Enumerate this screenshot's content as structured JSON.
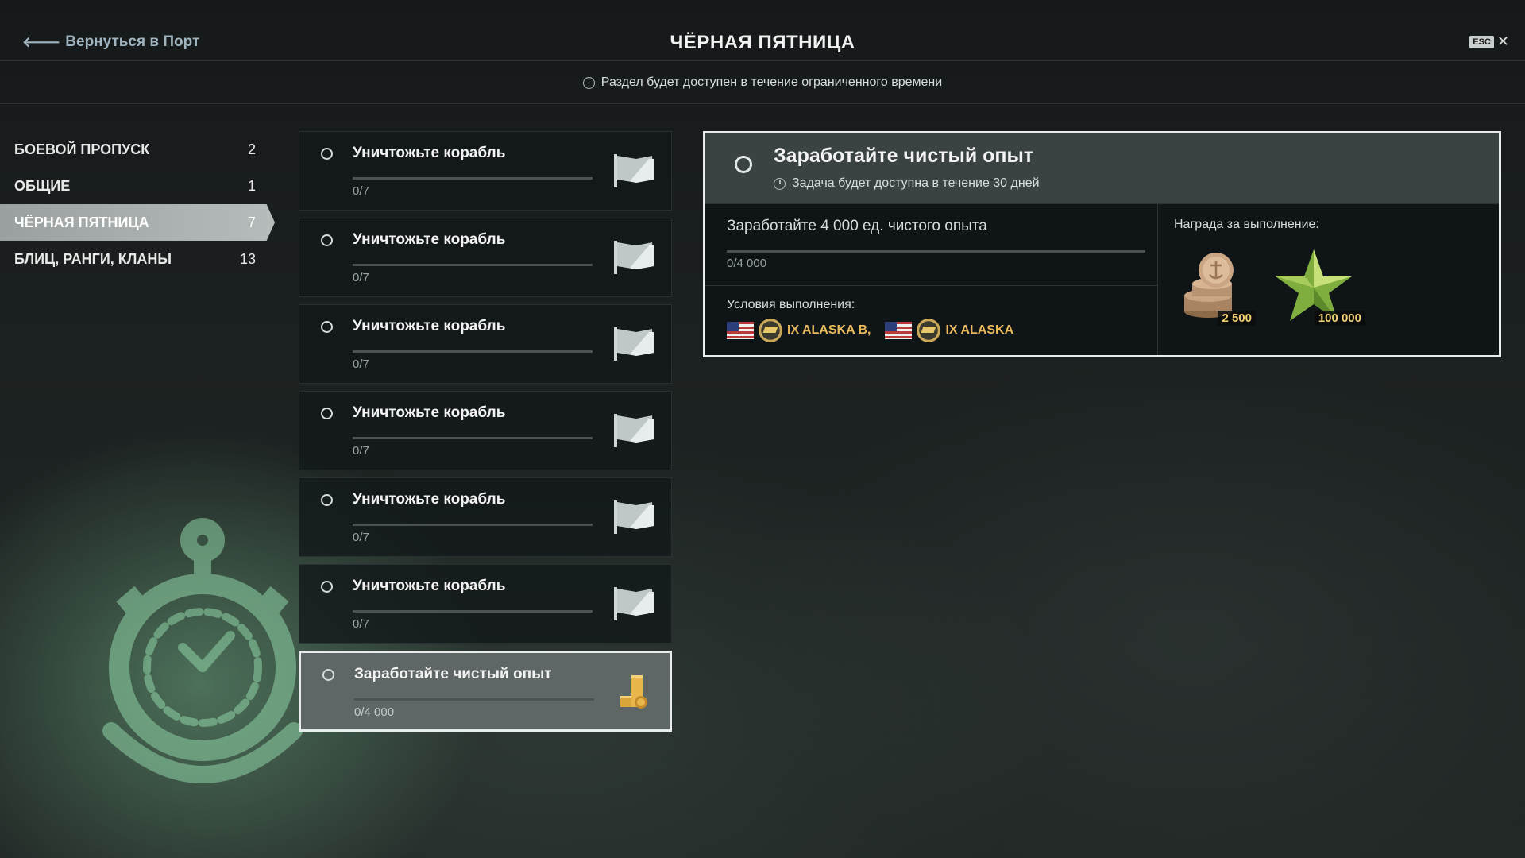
{
  "header": {
    "back_label": "Вернуться в Порт",
    "title": "ЧЁРНАЯ ПЯТНИЦА",
    "esc_key": "ESC",
    "notice": "Раздел будет доступен в течение ограниченного времени"
  },
  "sidebar": {
    "items": [
      {
        "label": "БОЕВОЙ ПРОПУСК",
        "count": "2",
        "active": false
      },
      {
        "label": "ОБЩИЕ",
        "count": "1",
        "active": false
      },
      {
        "label": "ЧЁРНАЯ ПЯТНИЦА",
        "count": "7",
        "active": true
      },
      {
        "label": "БЛИЦ, РАНГИ, КЛАНЫ",
        "count": "13",
        "active": false
      }
    ]
  },
  "tasks": [
    {
      "name": "Уничтожьте корабль",
      "progress": "0/7",
      "icon": "flag-icon"
    },
    {
      "name": "Уничтожьте корабль",
      "progress": "0/7",
      "icon": "flag-icon"
    },
    {
      "name": "Уничтожьте корабль",
      "progress": "0/7",
      "icon": "flag-icon"
    },
    {
      "name": "Уничтожьте корабль",
      "progress": "0/7",
      "icon": "flag-icon"
    },
    {
      "name": "Уничтожьте корабль",
      "progress": "0/7",
      "icon": "flag-icon"
    },
    {
      "name": "Уничтожьте корабль",
      "progress": "0/7",
      "icon": "flag-icon"
    },
    {
      "name": "Заработайте чистый опыт",
      "progress": "0/4 000",
      "icon": "coins-icon",
      "selected": true
    }
  ],
  "detail": {
    "title": "Заработайте чистый опыт",
    "availability": "Задача будет доступна в течение 30 дней",
    "task_text": "Заработайте 4 000 ед. чистого опыта",
    "progress": "0/4 000",
    "conditions_label": "Условия выполнения:",
    "ship1": "IX ALASKA B,",
    "ship2": "IX ALASKA",
    "reward_label": "Награда за выполнение:",
    "reward_credits": "2 500",
    "reward_xp": "100 000"
  },
  "colors": {
    "accent_gold": "#e9b85a",
    "reward_value": "#f2cf72",
    "active_tab": "#b6bcbb"
  }
}
